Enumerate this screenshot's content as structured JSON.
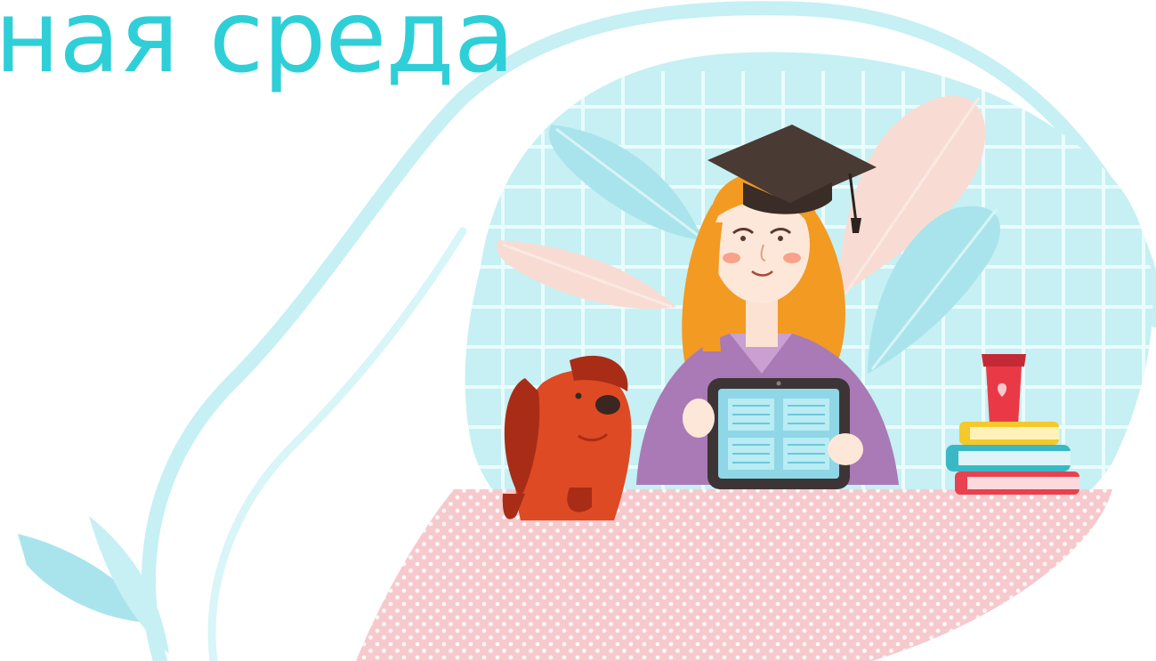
{
  "header": {
    "title_fragment": "ная среда"
  },
  "colors": {
    "title": "#2fcfd8",
    "outline": "#bfeef2",
    "backdrop": "#c6f0f3",
    "grid": "#eafcfd",
    "tablecloth": "#f6c9cd",
    "hair": "#f39a22",
    "sweater": "#a97ab6",
    "cap": "#4a3a34",
    "dog": "#de4a24",
    "dog_ear": "#a92c17",
    "tablet_frame": "#3d3535",
    "tablet_screen": "#8fd7e6",
    "cup": "#ea3946",
    "book_yellow": "#f5c82b",
    "book_teal": "#39b9c6",
    "book_red": "#e8414f"
  },
  "illustration": {
    "subject": "student-with-tablet",
    "icons": [
      "graduation-cap-icon",
      "tablet-icon",
      "dog-icon",
      "coffee-cup-icon",
      "book-stack-icon",
      "leaf-icon"
    ]
  }
}
